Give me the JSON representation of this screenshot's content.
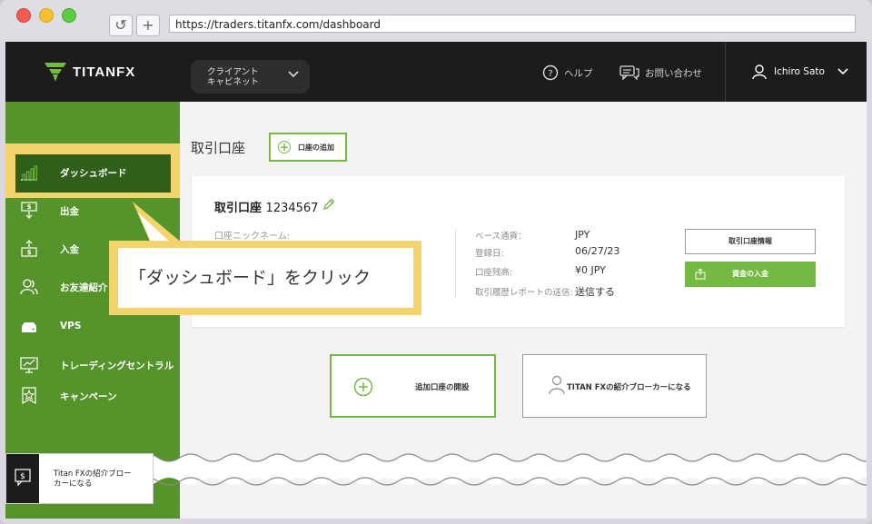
{
  "browser": {
    "url": "https://traders.titanfx.com/dashboard",
    "reload_glyph": "↺",
    "new_tab_glyph": "+"
  },
  "header": {
    "logo_text": "TITANFX",
    "cabinet_line1": "クライアント",
    "cabinet_line2": "キャビネット",
    "help": "ヘルプ",
    "contact": "お問い合わせ",
    "user_name": "Ichiro Sato"
  },
  "sidebar": {
    "items": [
      {
        "label": "ダッシュボード",
        "icon": "bar-chart-icon"
      },
      {
        "label": "出金",
        "icon": "withdraw-icon"
      },
      {
        "label": "入金",
        "icon": "deposit-icon"
      },
      {
        "label": "お友達紹介",
        "icon": "users-icon"
      },
      {
        "label": "VPS",
        "icon": "server-icon"
      },
      {
        "label": "トレーディングセントラル",
        "icon": "monitor-chart-icon"
      },
      {
        "label": "キャンペーン",
        "icon": "badge-star-icon"
      }
    ]
  },
  "main": {
    "title": "取引口座",
    "add_account": "口座の追加",
    "account": {
      "title": "取引口座",
      "number": "1234567",
      "nickname_label": "口座ニックネーム:",
      "fields": [
        {
          "label": "ベース通貨：",
          "value": "JPY"
        },
        {
          "label": "登録日:",
          "value": "06/27/23"
        },
        {
          "label": "口座残高:",
          "value": "¥0 JPY"
        },
        {
          "label": "取引履歴レポートの送信:",
          "value": "送信する"
        }
      ],
      "info_button": "取引口座情報",
      "deposit_button": "資金の入金"
    },
    "open_additional": "追加口座の開設",
    "become_ib": "TITAN FXの紹介ブローカーになる"
  },
  "callout": {
    "text": "「ダッシュボード」をクリック"
  },
  "referral_card": {
    "line1": "Titan FXの紹介ブロー",
    "line2": "カーになる"
  },
  "colors": {
    "sidebar_green": "#55932b",
    "accent_green": "#74b942",
    "header_dark": "#1c1c1c",
    "highlight_yellow": "#f2d36c"
  }
}
